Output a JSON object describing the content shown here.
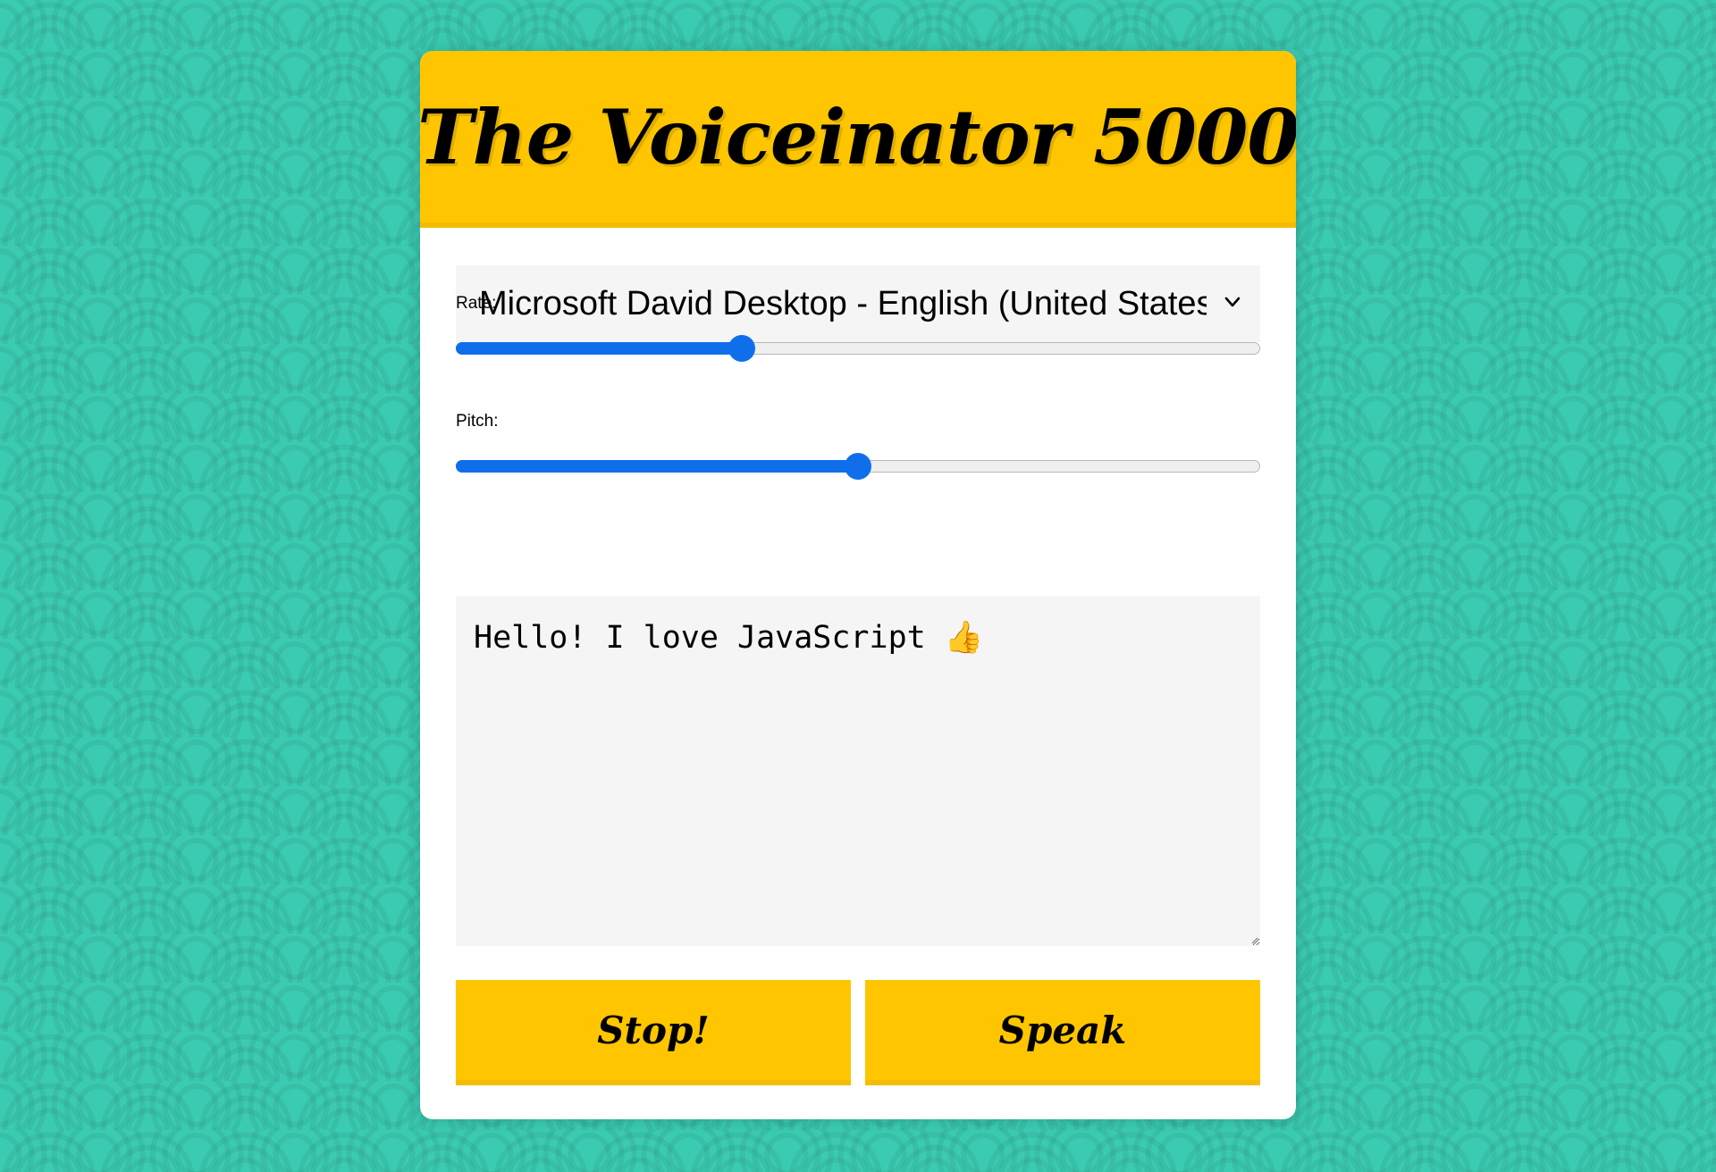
{
  "header": {
    "title": "The Voiceinator 5000"
  },
  "voice_select": {
    "selected": "Microsoft David Desktop - English (United States)"
  },
  "rate": {
    "label": "Rate:",
    "value_fraction": 0.35
  },
  "pitch": {
    "label": "Pitch:",
    "value_fraction": 0.5
  },
  "message": {
    "value": "Hello! I love JavaScript 👍"
  },
  "buttons": {
    "stop_label": "Stop!",
    "speak_label": "Speak"
  },
  "colors": {
    "background": "#3BCBB3",
    "accent_yellow": "#FFC600",
    "slider_blue": "#0F6FEB",
    "field_gray": "#F5F5F5"
  },
  "icons": {
    "select_arrow": "chevron-down-icon",
    "textarea_corner": "resize-grip-icon"
  }
}
